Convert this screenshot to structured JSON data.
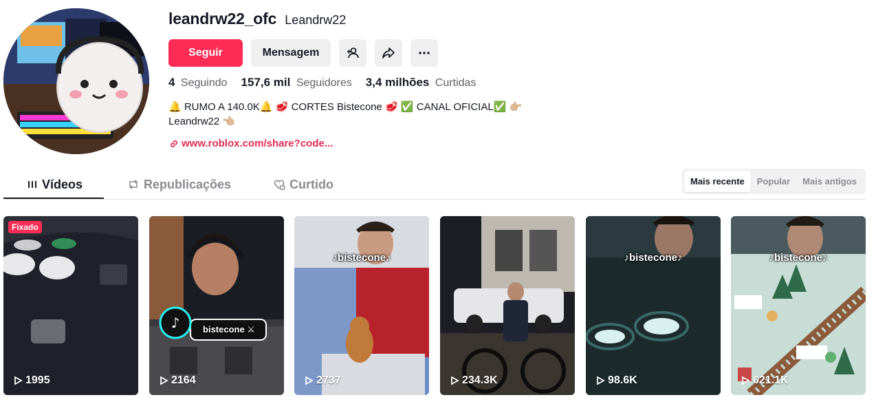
{
  "profile": {
    "username": "leandrw22_ofc",
    "nickname": "Leandrw22",
    "follow_label": "Seguir",
    "message_label": "Mensagem",
    "stats": [
      {
        "value": "4",
        "label": "Seguindo"
      },
      {
        "value": "157,6 mil",
        "label": "Seguidores"
      },
      {
        "value": "3,4 milhões",
        "label": "Curtidas"
      }
    ],
    "bio_line1": "🔔 RUMO A 140.0K🔔  🥩 CORTES Bistecone 🥩  ✅ CANAL OFICIAL✅  👉🏼",
    "bio_line2": "Leandrw22 👈🏼",
    "link": "www.roblox.com/share?code..."
  },
  "tabs": [
    {
      "label": "Vídeos",
      "icon": "grid-icon"
    },
    {
      "label": "Republicações",
      "icon": "repost-icon"
    },
    {
      "label": "Curtido",
      "icon": "heart-lock-icon"
    }
  ],
  "sort": [
    "Mais recente",
    "Popular",
    "Mais antigos"
  ],
  "videos": [
    {
      "views": "1995",
      "pinned": "Fixado",
      "watermark": ""
    },
    {
      "views": "2164",
      "pinned": "",
      "watermark": "bistecone ⚔"
    },
    {
      "views": "2737",
      "pinned": "",
      "watermark": "♪bistecone♪"
    },
    {
      "views": "234.3K",
      "pinned": "",
      "watermark": ""
    },
    {
      "views": "98.6K",
      "pinned": "",
      "watermark": "♪bistecone♪"
    },
    {
      "views": "621.1K",
      "pinned": "",
      "watermark": "♪bistecone♪"
    }
  ],
  "colors": {
    "accent": "#fe2c55",
    "link": "#e12c55",
    "text": "#161823",
    "muted": "#8a8b91"
  }
}
